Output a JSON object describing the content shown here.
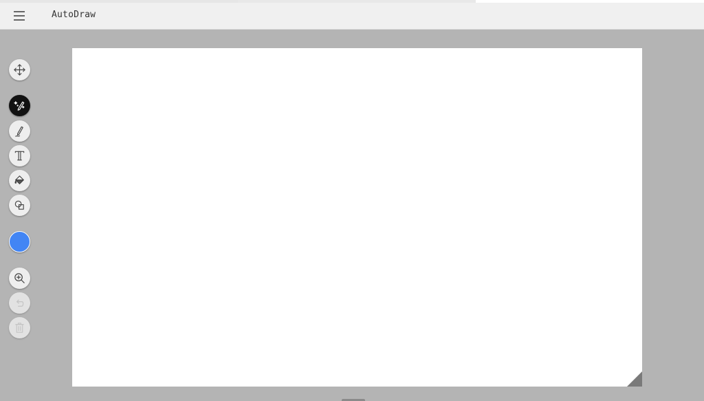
{
  "app": {
    "title": "AutoDraw"
  },
  "toolbar": {
    "tools": [
      {
        "name": "move",
        "icon": "move-arrows-icon",
        "state": "normal"
      },
      {
        "name": "autodraw",
        "icon": "autodraw-pencil-sparkle-icon",
        "state": "active"
      },
      {
        "name": "draw",
        "icon": "pencil-icon",
        "state": "normal"
      },
      {
        "name": "type",
        "icon": "text-type-icon",
        "state": "normal"
      },
      {
        "name": "fill",
        "icon": "paint-bucket-icon",
        "state": "normal"
      },
      {
        "name": "shape",
        "icon": "shapes-icon",
        "state": "normal"
      },
      {
        "name": "zoom",
        "icon": "zoom-in-icon",
        "state": "normal"
      },
      {
        "name": "undo",
        "icon": "undo-icon",
        "state": "disabled"
      },
      {
        "name": "delete",
        "icon": "trash-icon",
        "state": "disabled"
      }
    ],
    "selected_color": "#4285f4"
  },
  "colors": {
    "workspace_bg": "#b4b4b4",
    "header_bg": "#f0f0f0",
    "active_tool_bg": "#111111",
    "canvas_bg": "#ffffff"
  }
}
